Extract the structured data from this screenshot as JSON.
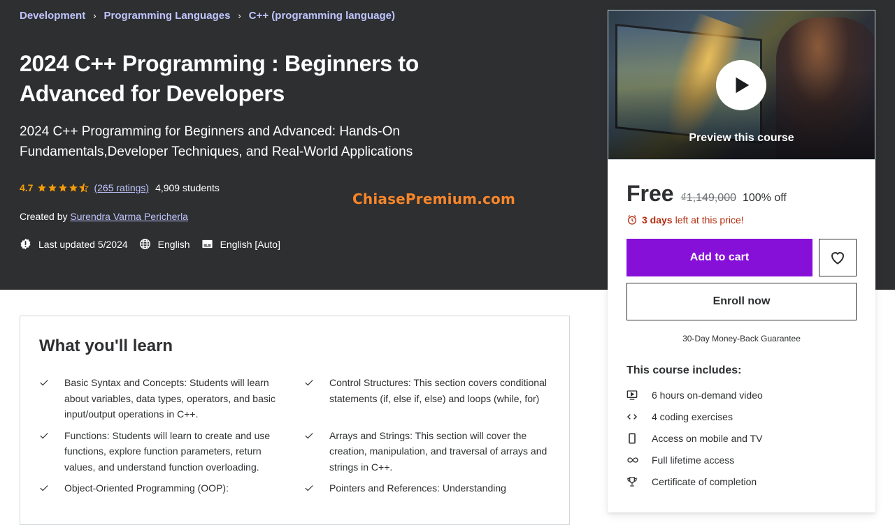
{
  "breadcrumb": {
    "items": [
      "Development",
      "Programming Languages",
      "C++ (programming language)"
    ],
    "separator": "›"
  },
  "course": {
    "title": "2024 C++ Programming : Beginners to Advanced for Developers",
    "subtitle": "2024 C++ Programming for Beginners and Advanced: Hands-On Fundamentals,Developer Techniques, and Real-World Applications",
    "rating": "4.7",
    "rating_stars_value": 4.7,
    "rating_stars_max": 5,
    "ratings_count": "(265 ratings)",
    "students": "4,909 students",
    "created_by_label": "Created by",
    "instructor": "Surendra Varma Pericherla",
    "last_updated": "Last updated 5/2024",
    "language": "English",
    "captions": "English [Auto]"
  },
  "watermark": "ChiasePremium.com",
  "sidebar": {
    "preview_label": "Preview this course",
    "price": "Free",
    "original_price": "₫1,149,000",
    "discount": "100% off",
    "countdown_bold": "3 days",
    "countdown_rest": "left at this price!",
    "add_to_cart": "Add to cart",
    "enroll_now": "Enroll now",
    "guarantee": "30-Day Money-Back Guarantee",
    "includes_title": "This course includes:",
    "includes": [
      {
        "icon": "video-icon",
        "label": "6 hours on-demand video"
      },
      {
        "icon": "code-icon",
        "label": "4 coding exercises"
      },
      {
        "icon": "mobile-icon",
        "label": "Access on mobile and TV"
      },
      {
        "icon": "infinity-icon",
        "label": "Full lifetime access"
      },
      {
        "icon": "trophy-icon",
        "label": "Certificate of completion"
      }
    ]
  },
  "learn": {
    "title": "What you'll learn",
    "items": [
      "Basic Syntax and Concepts: Students will learn about variables, data types, operators, and basic input/output operations in C++.",
      "Control Structures: This section covers conditional statements (if, else if, else) and loops (while, for)",
      "Functions: Students will learn to create and use functions, explore function parameters, return values, and understand function overloading.",
      "Arrays and Strings: This section will cover the creation, manipulation, and traversal of arrays and strings in C++.",
      "Object-Oriented Programming (OOP):",
      "Pointers and References: Understanding"
    ]
  },
  "colors": {
    "hero_bg": "#2d2f31",
    "link": "#c0c4fc",
    "star": "#f69c08",
    "primary_button": "#8710d8",
    "countdown": "#b32d0f",
    "watermark": "#f8862a"
  }
}
